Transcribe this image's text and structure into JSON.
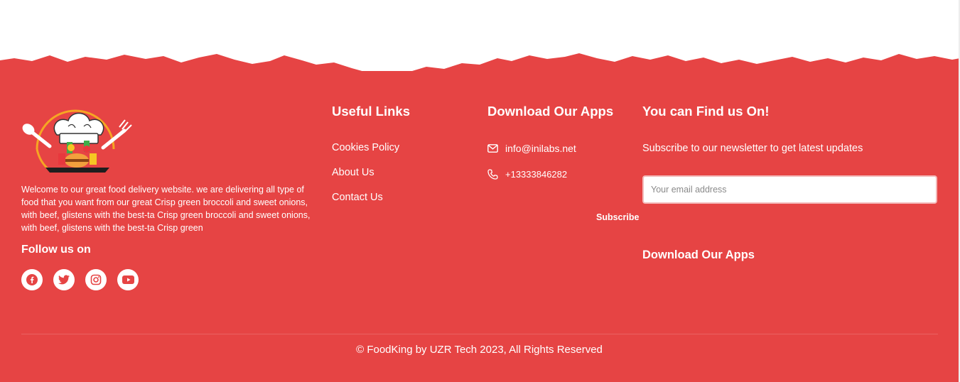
{
  "brand": {
    "logo_alt": "FoodKing chef logo"
  },
  "about": {
    "text": "Welcome to our great food delivery website. we are delivering all type of food that you want from our great Crisp green broccoli and sweet onions, with beef, glistens with the best-ta Crisp green broccoli and sweet onions, with beef, glistens with the best-ta Crisp green"
  },
  "follow": {
    "title": "Follow us on",
    "socials": [
      {
        "name": "facebook-icon"
      },
      {
        "name": "twitter-icon"
      },
      {
        "name": "instagram-icon"
      },
      {
        "name": "youtube-icon"
      }
    ]
  },
  "useful_links": {
    "title": "Useful Links",
    "items": [
      "Cookies Policy",
      "About Us",
      "Contact Us"
    ]
  },
  "download_apps": {
    "title": "Download Our Apps",
    "email": "info@inilabs.net",
    "phone": "+13333846282"
  },
  "find_us": {
    "title": "You can Find us On!",
    "newsletter_text": "Subscribe to our newsletter to get latest updates",
    "email_placeholder": "Your email address",
    "subscribe_label": "Subscribe",
    "apps_title": "Download Our Apps"
  },
  "footer": {
    "copyright": "© FoodKing by UZR Tech 2023, All Rights Reserved"
  },
  "colors": {
    "footer_bg": "#e64444",
    "text": "#ffffff"
  }
}
